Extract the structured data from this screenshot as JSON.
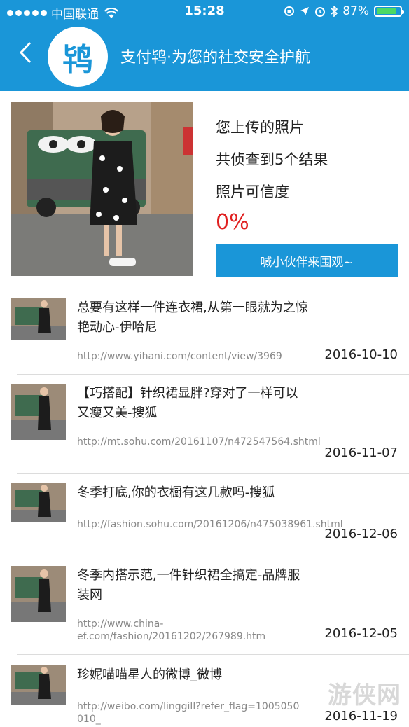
{
  "status_bar": {
    "carrier": "中国联通",
    "time": "15:28",
    "battery": "87%",
    "battery_level": 0.87
  },
  "header": {
    "logo_text": "鸨",
    "title": "支付鸨·为您的社交安全护航"
  },
  "summary": {
    "line1": "您上传的照片",
    "line2": "共侦查到5个结果",
    "line3": "照片可信度",
    "credibility": "0%",
    "share_button": "喊小伙伴来围观~"
  },
  "results": [
    {
      "title": "总要有这样一件连衣裙,从第一眼就为之惊艳动心-伊哈尼",
      "url": "http://www.yihani.com/content/view/3969",
      "date": "2016-10-10"
    },
    {
      "title": "【巧搭配】针织裙显胖?穿对了一样可以又瘦又美-搜狐",
      "url": "http://mt.sohu.com/20161107/n472547564.shtml",
      "date": "2016-11-07"
    },
    {
      "title": "冬季打底,你的衣橱有这几款吗-搜狐",
      "url": "http://fashion.sohu.com/20161206/n475038961.shtml",
      "date": "2016-12-06"
    },
    {
      "title": "冬季内搭示范,一件针织裙全搞定-品牌服装网",
      "url": "http://www.china-ef.com/fashion/20161202/267989.htm",
      "date": "2016-12-05"
    },
    {
      "title": "珍妮喵喵星人的微博_微博",
      "url": "http://weibo.com/linggill?refer_flag=1005050010_",
      "date": "2016-11-19"
    }
  ],
  "watermark": "游侠网",
  "colors": {
    "brand_blue": "#1a96d8",
    "credibility_red": "#e02020"
  }
}
